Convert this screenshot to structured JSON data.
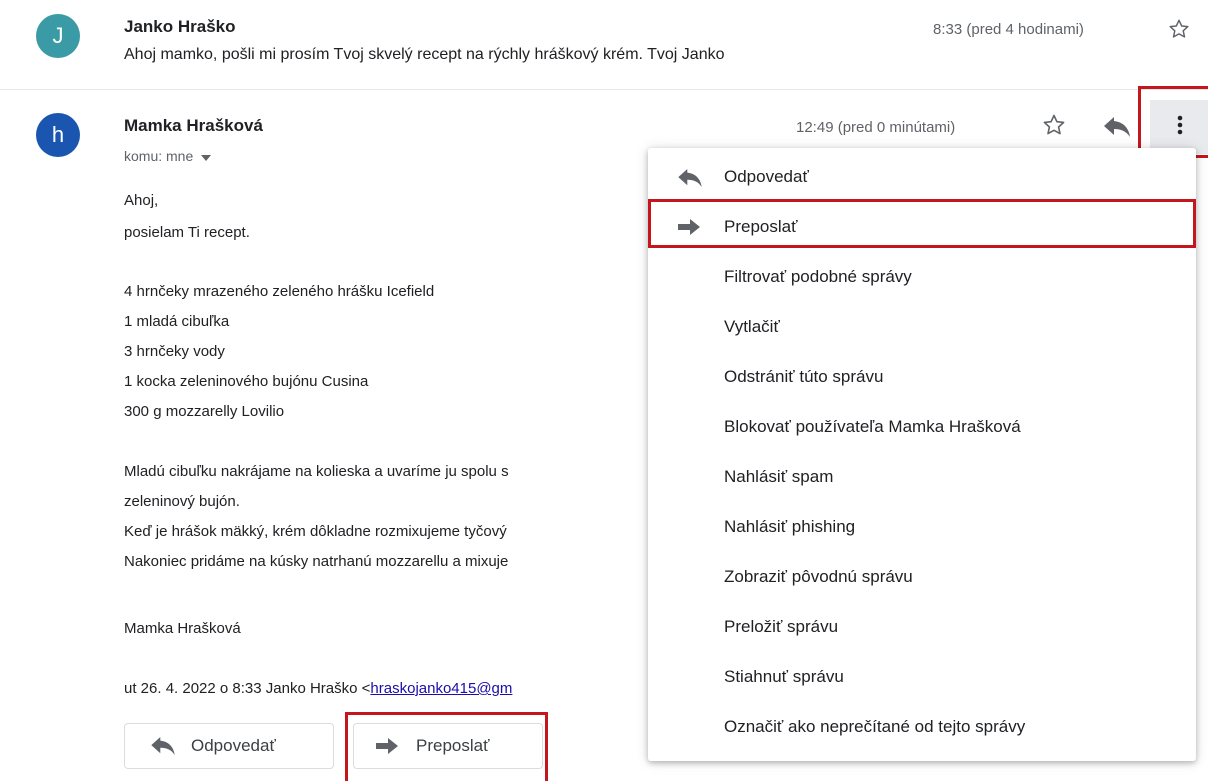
{
  "email1": {
    "avatar_letter": "J",
    "avatar_color": "#3a9aa5",
    "sender": "Janko Hraško",
    "time": "8:33 (pred 4 hodinami)",
    "snippet": "Ahoj mamko, pošli mi prosím Tvoj skvelý recept na rýchly hráškový krém. Tvoj Janko"
  },
  "email2": {
    "avatar_letter": "h",
    "avatar_color": "#1a56b0",
    "sender": "Mamka Hrašková",
    "time": "12:49 (pred 0 minútami)",
    "to": "komu: mne",
    "body": [
      "Ahoj,",
      "posielam Ti recept.",
      "4 hrnčeky mrazeného zeleného hrášku Icefield",
      "1 mladá cibuľka",
      "3 hrnčeky vody",
      "1 kocka zeleninového bujónu Cusina",
      "300 g mozzarelly Lovilio",
      "Mladú cibuľku nakrájame na kolieska a uvaríme ju spolu s",
      "zeleninový bujón.",
      "Keď je hrášok mäkký, krém dôkladne rozmixujeme tyčový",
      "Nakoniec pridáme na kúsky natrhanú mozzarellu a mixuje",
      "Mamka Hrašková"
    ],
    "quote_prefix": "ut 26. 4. 2022 o 8:33 Janko Hraško <",
    "quote_email": "hraskojanko415@gm"
  },
  "actions": {
    "reply_label": "Odpovedať",
    "forward_label": "Preposlať"
  },
  "menu": {
    "items": [
      "Odpovedať",
      "Preposlať",
      "Filtrovať podobné správy",
      "Vytlačiť",
      "Odstrániť túto správu",
      "Blokovať používateľa Mamka Hrašková",
      "Nahlásiť spam",
      "Nahlásiť phishing",
      "Zobraziť pôvodnú správu",
      "Preložiť správu",
      "Stiahnuť správu",
      "Označiť ako neprečítané od tejto správy"
    ]
  },
  "colors": {
    "highlight": "#c5161d",
    "icon_gray": "#5f6368"
  },
  "icons": [
    "star-icon",
    "reply-icon",
    "more-vert-icon",
    "forward-icon",
    "dropdown-arrow-icon"
  ]
}
